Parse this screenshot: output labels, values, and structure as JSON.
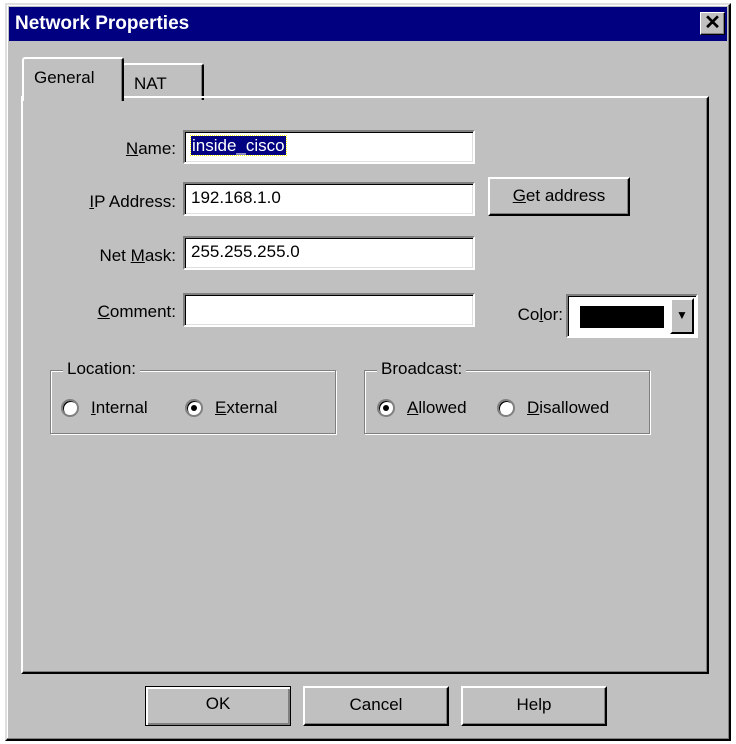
{
  "window": {
    "title": "Network Properties",
    "close_glyph": "✕"
  },
  "tabs": [
    {
      "label": "General",
      "selected": true
    },
    {
      "label": "NAT",
      "selected": false
    }
  ],
  "form": {
    "name": {
      "label_mnemonic": "N",
      "label_rest": "ame:",
      "value": "inside_cisco",
      "selected": true
    },
    "ip": {
      "label_mnemonic": "I",
      "label_rest": "P Address:",
      "value": "192.168.1.0"
    },
    "mask": {
      "label_pre": "Net ",
      "label_mnemonic": "M",
      "label_rest": "ask:",
      "value": "255.255.255.0"
    },
    "comment": {
      "label_mnemonic": "C",
      "label_rest": "omment:",
      "value": ""
    },
    "get_address": {
      "mnemonic": "G",
      "rest": "et address"
    },
    "color": {
      "label_pre": "Co",
      "label_mnemonic": "l",
      "label_rest": "or:",
      "value": "#000000"
    }
  },
  "location": {
    "title": "Location:",
    "internal": {
      "mnemonic": "I",
      "rest": "nternal",
      "checked": false
    },
    "external": {
      "mnemonic": "E",
      "rest": "xternal",
      "checked": true
    }
  },
  "broadcast": {
    "title": "Broadcast:",
    "allowed": {
      "mnemonic": "A",
      "rest": "llowed",
      "checked": true
    },
    "disallowed": {
      "mnemonic": "D",
      "rest": "isallowed",
      "checked": false
    }
  },
  "buttons": {
    "ok": "OK",
    "cancel": "Cancel",
    "help": "Help"
  }
}
